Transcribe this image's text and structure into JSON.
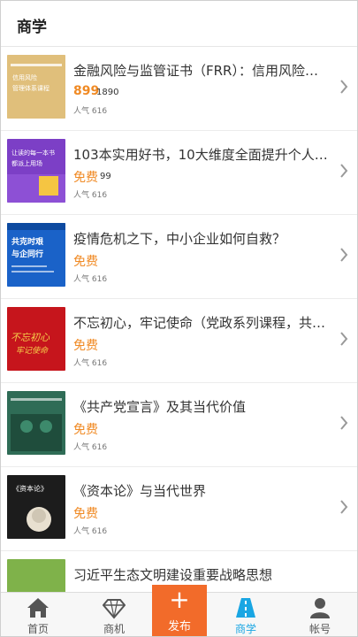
{
  "header": {
    "title": "商学"
  },
  "items": [
    {
      "title": "金融风险与监管证书（FRR）：信用风险…",
      "price": "899",
      "original_price": "1890",
      "popularity": "人气 616",
      "cover": {
        "bg": "#d8b46a",
        "lines": [
          "金融风险与监管证书",
          "信用风险",
          "管理体系课程"
        ]
      }
    },
    {
      "title": "103本实用好书，10大维度全面提升个人…",
      "price": "免费",
      "original_price": "99",
      "popularity": "人气 616",
      "cover": {
        "bg": "#7a3fc4",
        "lines": [
          "让读的每一本书",
          "都派上用场"
        ]
      }
    },
    {
      "title": "疫情危机之下，中小企业如何自救？",
      "price": "免费",
      "original_price": "",
      "popularity": "人气 616",
      "cover": {
        "bg": "#1b64c9",
        "lines": [
          "共克时艰",
          "与企同行"
        ]
      }
    },
    {
      "title": "不忘初心，牢记使命（党政系列课程，共…",
      "price": "免费",
      "original_price": "",
      "popularity": "人气 616",
      "cover": {
        "bg": "#c8141b",
        "lines": [
          "不忘初心",
          "牢记使命"
        ]
      }
    },
    {
      "title": "《共产党宣言》及其当代价值",
      "price": "免费",
      "original_price": "",
      "popularity": "人气 616",
      "cover": {
        "bg": "#2e6b55",
        "lines": [
          "《共产党宣言》及其当代价值"
        ]
      }
    },
    {
      "title": "《资本论》与当代世界",
      "price": "免费",
      "original_price": "",
      "popularity": "人气 616",
      "cover": {
        "bg": "#1e1e1e",
        "lines": [
          "《资本论》",
          "与当代世界"
        ]
      }
    },
    {
      "title": "习近平生态文明建设重要战略思想",
      "price": "",
      "original_price": "",
      "popularity": "",
      "cover": {
        "bg": "#7fb24a",
        "lines": []
      }
    }
  ],
  "tabbar": {
    "tabs": [
      {
        "label": "首页",
        "icon": "home-icon"
      },
      {
        "label": "商机",
        "icon": "diamond-icon"
      },
      {
        "label": "商学",
        "icon": "road-icon"
      },
      {
        "label": "帐号",
        "icon": "user-icon"
      }
    ],
    "publish": {
      "label": "发布",
      "icon": "plus-icon"
    },
    "active_color": "#19a6e3",
    "publish_color": "#f26b2a"
  }
}
